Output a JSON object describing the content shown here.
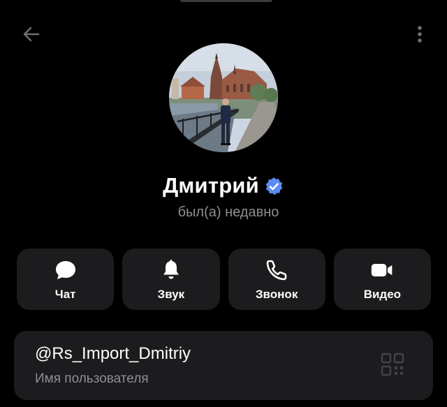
{
  "header": {
    "back_icon": "arrow-left-icon",
    "menu_icon": "more-vertical-icon"
  },
  "profile": {
    "name": "Дмитрий",
    "verified_icon": "verified-badge-icon",
    "status": "был(а) недавно",
    "accent_color": "#5b8cf0"
  },
  "actions": [
    {
      "label": "Чат",
      "icon": "chat-bubble-icon"
    },
    {
      "label": "Звук",
      "icon": "bell-icon"
    },
    {
      "label": "Звонок",
      "icon": "phone-icon"
    },
    {
      "label": "Видео",
      "icon": "video-camera-icon"
    }
  ],
  "info": {
    "username": "@Rs_Import_Dmitriy",
    "username_caption": "Имя пользователя",
    "qr_icon": "qr-code-icon"
  },
  "colors": {
    "background": "#000000",
    "card": "#1c1c1e",
    "secondary_text": "#8e8e93"
  }
}
